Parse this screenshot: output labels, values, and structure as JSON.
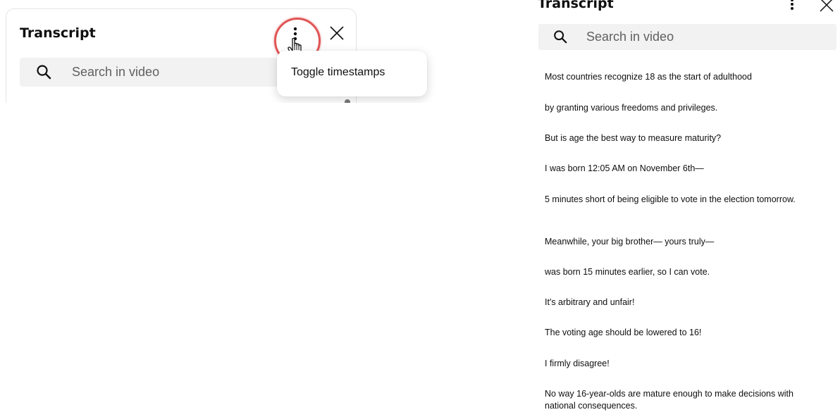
{
  "left_panel": {
    "title": "Transcript",
    "search_placeholder": "Search in video",
    "menu": {
      "items": [
        {
          "label": "Toggle timestamps"
        }
      ]
    },
    "highlight_color": "#e05555"
  },
  "right_panel": {
    "title": "Transcript",
    "search_placeholder": "Search in video",
    "segments": [
      {
        "text": "Most countries recognize 18 as the start of adulthood"
      },
      {
        "text": "by granting various freedoms and privileges."
      },
      {
        "text": "But is age the best way to measure maturity?"
      },
      {
        "text": "I was born 12:05 AM on November 6th—"
      },
      {
        "text": "5 minutes short of being eligible to vote in the election tomorrow."
      },
      {
        "text": "Meanwhile, your big brother— yours truly—"
      },
      {
        "text": "was born 15 minutes earlier, so I can vote."
      },
      {
        "text": "It's arbitrary and unfair!"
      },
      {
        "text": "The voting age should be lowered to 16!"
      },
      {
        "text": "I firmly disagree!"
      },
      {
        "text": "No way 16-year-olds are mature enough to make decisions with national consequences."
      }
    ]
  },
  "icons": {
    "search": "search-icon",
    "more": "more-vert-icon",
    "close": "close-icon",
    "cursor": "hand-pointer-icon"
  },
  "colors": {
    "search_bg": "#f2f2f2",
    "text": "#0f0f0f",
    "placeholder": "#606060"
  }
}
